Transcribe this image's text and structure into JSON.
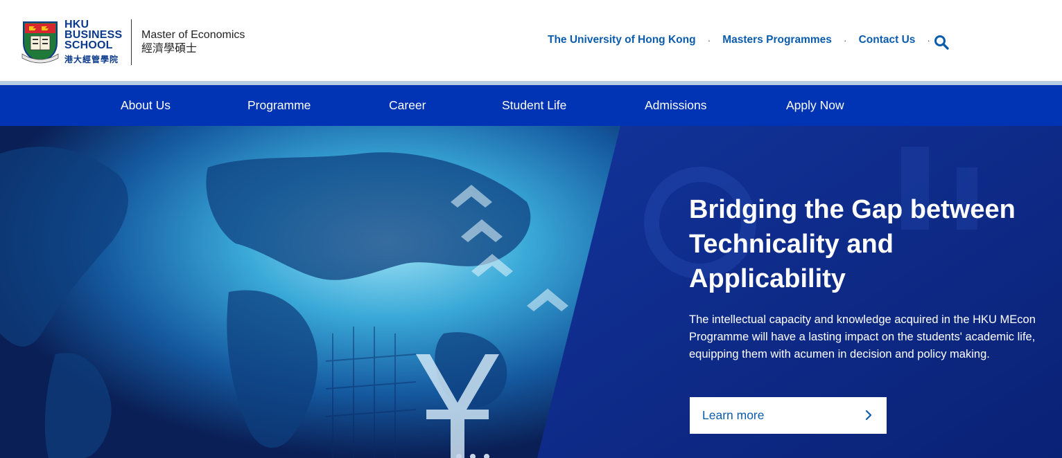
{
  "header": {
    "school_line1": "HKU",
    "school_line2": "BUSINESS",
    "school_line3": "SCHOOL",
    "school_zh": "港大經管學院",
    "programme_en": "Master of Economics",
    "programme_zh": "經濟學碩士",
    "links": [
      "The University of Hong Kong",
      "Masters Programmes",
      "Contact Us"
    ],
    "separator": "·",
    "search_icon": "search-icon"
  },
  "nav": {
    "items": [
      "About Us",
      "Programme",
      "Career",
      "Student Life",
      "Admissions",
      "Apply Now"
    ]
  },
  "hero": {
    "title_line1": "Bridging the Gap between",
    "title_line2": "Technicality and",
    "title_line3": "Applicability",
    "description": "The intellectual capacity and knowledge acquired in the HKU MEcon Programme will have a lasting impact on the students' academic life, equipping them with acumen in decision and policy making.",
    "cta_label": "Learn more"
  },
  "colors": {
    "nav_bg": "#0034b4",
    "link_blue": "#0b5cad",
    "brand_navy": "#0b3a8c",
    "hero_panel": "#0d2a8a"
  }
}
